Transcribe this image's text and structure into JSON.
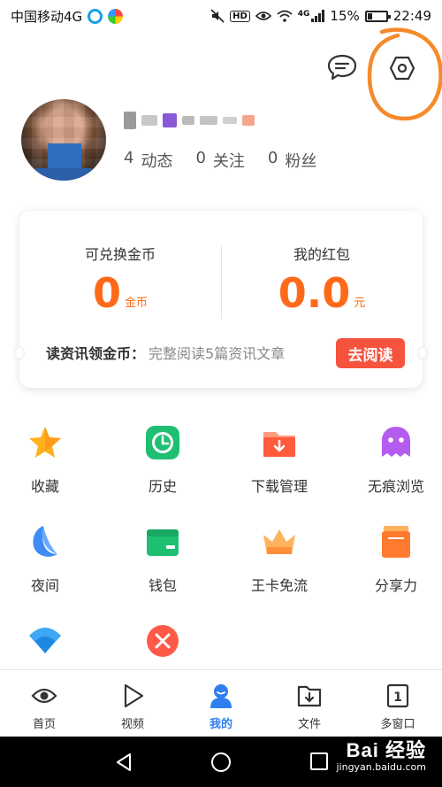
{
  "status_bar": {
    "carrier": "中国移动4G",
    "network_badge": "4G",
    "hd_badge": "HD",
    "battery_percent": "15%",
    "time": "22:49"
  },
  "profile": {
    "stats": [
      {
        "value": "4",
        "label": "动态"
      },
      {
        "value": "0",
        "label": "关注"
      },
      {
        "value": "0",
        "label": "粉丝"
      }
    ]
  },
  "wallet_card": {
    "coins_title": "可兑换金币",
    "coins_value": "0",
    "coins_unit": "金币",
    "redpacket_title": "我的红包",
    "redpacket_value": "0.0",
    "redpacket_unit": "元",
    "footer_label": "读资讯领金币：",
    "footer_desc": "完整阅读5篇资讯文章",
    "read_button": "去阅读"
  },
  "grid": [
    {
      "label": "收藏",
      "icon": "star-icon"
    },
    {
      "label": "历史",
      "icon": "clock-icon"
    },
    {
      "label": "下载管理",
      "icon": "download-folder-icon"
    },
    {
      "label": "无痕浏览",
      "icon": "ghost-icon"
    },
    {
      "label": "夜间",
      "icon": "moon-icon"
    },
    {
      "label": "钱包",
      "icon": "wallet-icon"
    },
    {
      "label": "王卡免流",
      "icon": "crown-icon"
    },
    {
      "label": "分享力",
      "icon": "share-icon"
    },
    {
      "label": "",
      "icon": "wifi-icon"
    },
    {
      "label": "",
      "icon": "close-circle-icon"
    }
  ],
  "bottom_nav": [
    {
      "label": "首页",
      "icon": "eye-icon"
    },
    {
      "label": "视频",
      "icon": "play-icon"
    },
    {
      "label": "我的",
      "icon": "user-icon",
      "active": true
    },
    {
      "label": "文件",
      "icon": "file-download-icon"
    },
    {
      "label": "多窗口",
      "icon": "window-icon"
    }
  ],
  "watermark": {
    "logo": "Bai 经验",
    "url": "jingyan.baidu.com"
  },
  "colors": {
    "accent_orange": "#ff6a1a",
    "button_red": "#f5533d",
    "nav_active_blue": "#2f7ff0",
    "annotation_orange": "#f58a2a"
  }
}
